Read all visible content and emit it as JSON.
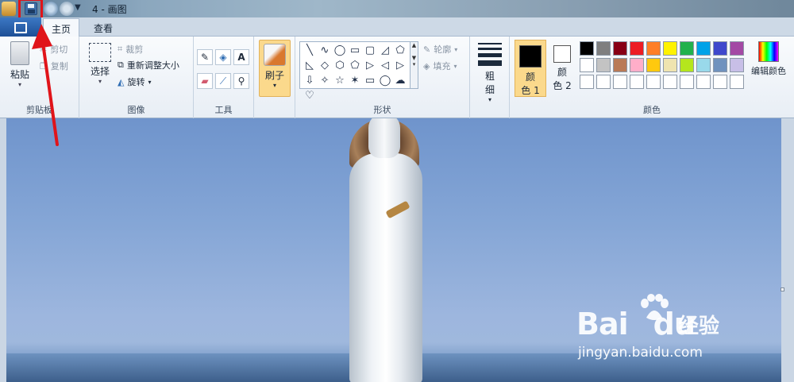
{
  "window": {
    "title": "4 - 画图"
  },
  "tabs": {
    "home": "主页",
    "view": "查看"
  },
  "clipboard": {
    "paste": "粘贴",
    "cut": "剪切",
    "copy": "复制",
    "label": "剪贴板"
  },
  "image": {
    "select": "选择",
    "crop": "裁剪",
    "resize": "重新调整大小",
    "rotate": "旋转",
    "label": "图像"
  },
  "tools": {
    "label": "工具",
    "text_icon": "A"
  },
  "brushes": {
    "label": "刷子"
  },
  "shapes": {
    "outline": "轮廓",
    "fill": "填充",
    "label": "形状",
    "glyphs": [
      "╲",
      "∿",
      "◯",
      "▭",
      "▢",
      "◿",
      "⬠",
      "◺",
      "◇",
      "⬡",
      "⬠",
      "▷",
      "◁",
      "▷",
      "⇩",
      "✧",
      "☆",
      "✶",
      "▭",
      "◯",
      "☁",
      "♡"
    ]
  },
  "size": {
    "label_line1": "粗",
    "label_line2": "细"
  },
  "colors": {
    "color1_line1": "颜",
    "color1_line2": "色 1",
    "color2_line1": "颜",
    "color2_line2": "色 2",
    "edit_colors": "编辑颜色",
    "label": "颜色",
    "color1": "#000000",
    "color2": "#ffffff",
    "row1": [
      "#000000",
      "#7f7f7f",
      "#880015",
      "#ed1c24",
      "#ff7f27",
      "#fff200",
      "#22b14c",
      "#00a2e8",
      "#3f48cc",
      "#a349a4"
    ],
    "row2": [
      "#ffffff",
      "#c3c3c3",
      "#b97a57",
      "#ffaec9",
      "#ffc90e",
      "#efe4b0",
      "#b5e61d",
      "#99d9ea",
      "#7092be",
      "#c8bfe7"
    ],
    "row3": [
      "#ffffff",
      "#ffffff",
      "#ffffff",
      "#ffffff",
      "#ffffff",
      "#ffffff",
      "#ffffff",
      "#ffffff",
      "#ffffff",
      "#ffffff"
    ]
  },
  "watermark": {
    "brand": "Bai",
    "brand_tail": "du",
    "cn": "经验",
    "url": "jingyan.baidu.com"
  }
}
